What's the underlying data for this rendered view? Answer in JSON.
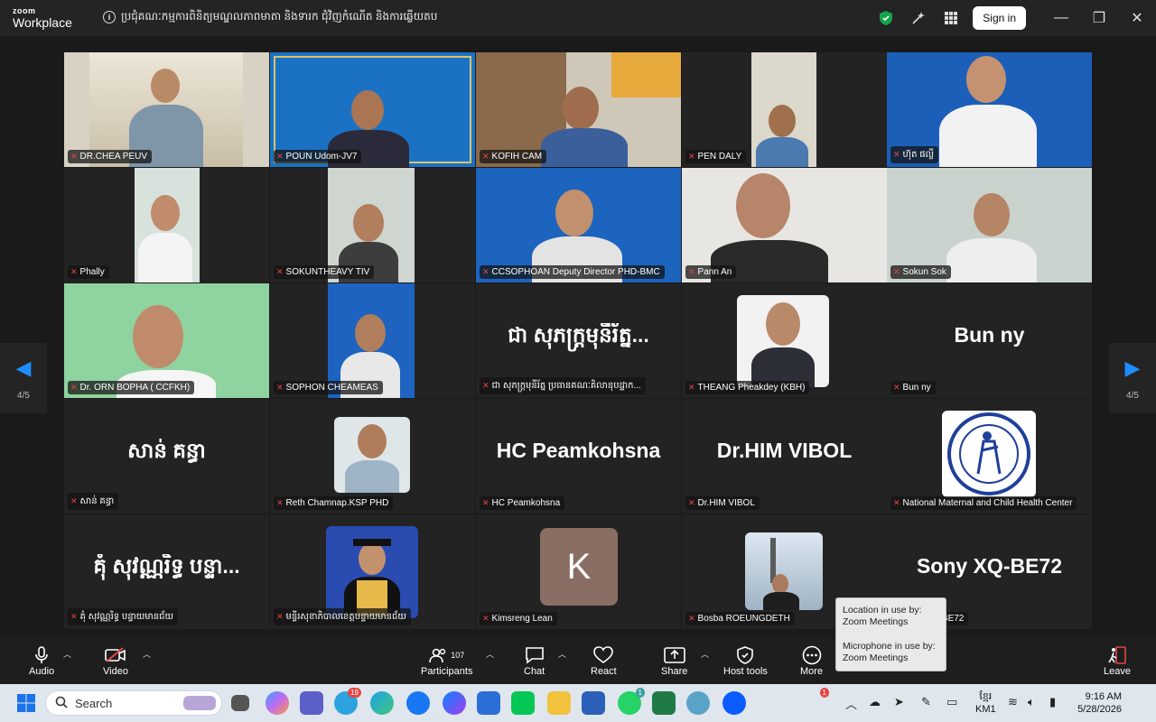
{
  "window": {
    "brand_top": "zoom",
    "brand_bottom": "Workplace",
    "meeting_title": "ប្រជុំគណៈកម្មការពិនិត្យមណ្ឌលភាពមាតា និងទារក ជុំវិញកំណើត និងការឆ្លើយតប",
    "signin_label": "Sign in"
  },
  "navigation": {
    "page_left": "4/5",
    "page_right": "4/5"
  },
  "participants": [
    {
      "name": "DR.CHEA PEUV"
    },
    {
      "name": "POUN Udom-JV7"
    },
    {
      "name": "KOFIH CAM"
    },
    {
      "name": "PEN DALY"
    },
    {
      "name": "ហ៊ុត ផល្លី"
    },
    {
      "name": "Phally"
    },
    {
      "name": "SOKUNTHEAVY TIV"
    },
    {
      "name": "CCSOPHOAN Deputy Director PHD-BMC"
    },
    {
      "name": "Pann An"
    },
    {
      "name": "Sokun Sok"
    },
    {
      "name": "Dr. ORN BOPHA ( CCFKH)"
    },
    {
      "name": "SOPHON CHEAMEAS"
    },
    {
      "name": "ជា សុភក្រ្តមុនីរ័ត្ន ប្រធានគណៈគិលានុបដ្ឋាក...",
      "display": "ជា សុភក្រ្តមុនីរ័ត្ន..."
    },
    {
      "name": "THEANG Pheakdey (KBH)"
    },
    {
      "name": "Bun ny",
      "display": "Bun ny"
    },
    {
      "name": "សាន់ គន្ធា",
      "display": "សាន់ គន្ធា"
    },
    {
      "name": "Reth Chamnap.KSP PHD"
    },
    {
      "name": "HC Peamkohsna",
      "display": "HC Peamkohsna"
    },
    {
      "name": "Dr.HIM VIBOL",
      "display": "Dr.HIM VIBOL"
    },
    {
      "name": "National Maternal and Child Health Center"
    },
    {
      "name": "គុំ សុវណ្ណរិទ្ធ បន្ទាយមានជ័យ",
      "display": "គុំ សុវណ្ណរិទ្ធ បន្ទា..."
    },
    {
      "name": "មន្ទីរសុខាភិបាលខេត្តបន្ទាយមានជ័យ"
    },
    {
      "name": "Kimsreng Lean",
      "avatar_letter": "K"
    },
    {
      "name": "Bosba ROEUNGDETH"
    },
    {
      "name": "Sony XQ-BE72",
      "display": "Sony XQ-BE72"
    }
  ],
  "tooltip": {
    "line1": "Location in use by:",
    "line2": "Zoom Meetings",
    "line3": "Microphone in use by:",
    "line4": "Zoom Meetings"
  },
  "toolbar": {
    "audio": "Audio",
    "video": "Video",
    "participants": "Participants",
    "participant_count": "107",
    "chat": "Chat",
    "react": "React",
    "share": "Share",
    "host_tools": "Host tools",
    "more": "More",
    "leave": "Leave"
  },
  "taskbar": {
    "search_placeholder": "Search",
    "telegram_badge": "19",
    "whatsapp_badge": "1",
    "notification_badge": "1",
    "lang_top": "ខ្មែរ",
    "lang_bottom": "KM1",
    "time": "9:16 AM",
    "date": "5/28/2026"
  },
  "colors": {
    "accent_blue": "#1e8eff",
    "mute_red": "#e64545",
    "shield_green": "#16a34a"
  }
}
